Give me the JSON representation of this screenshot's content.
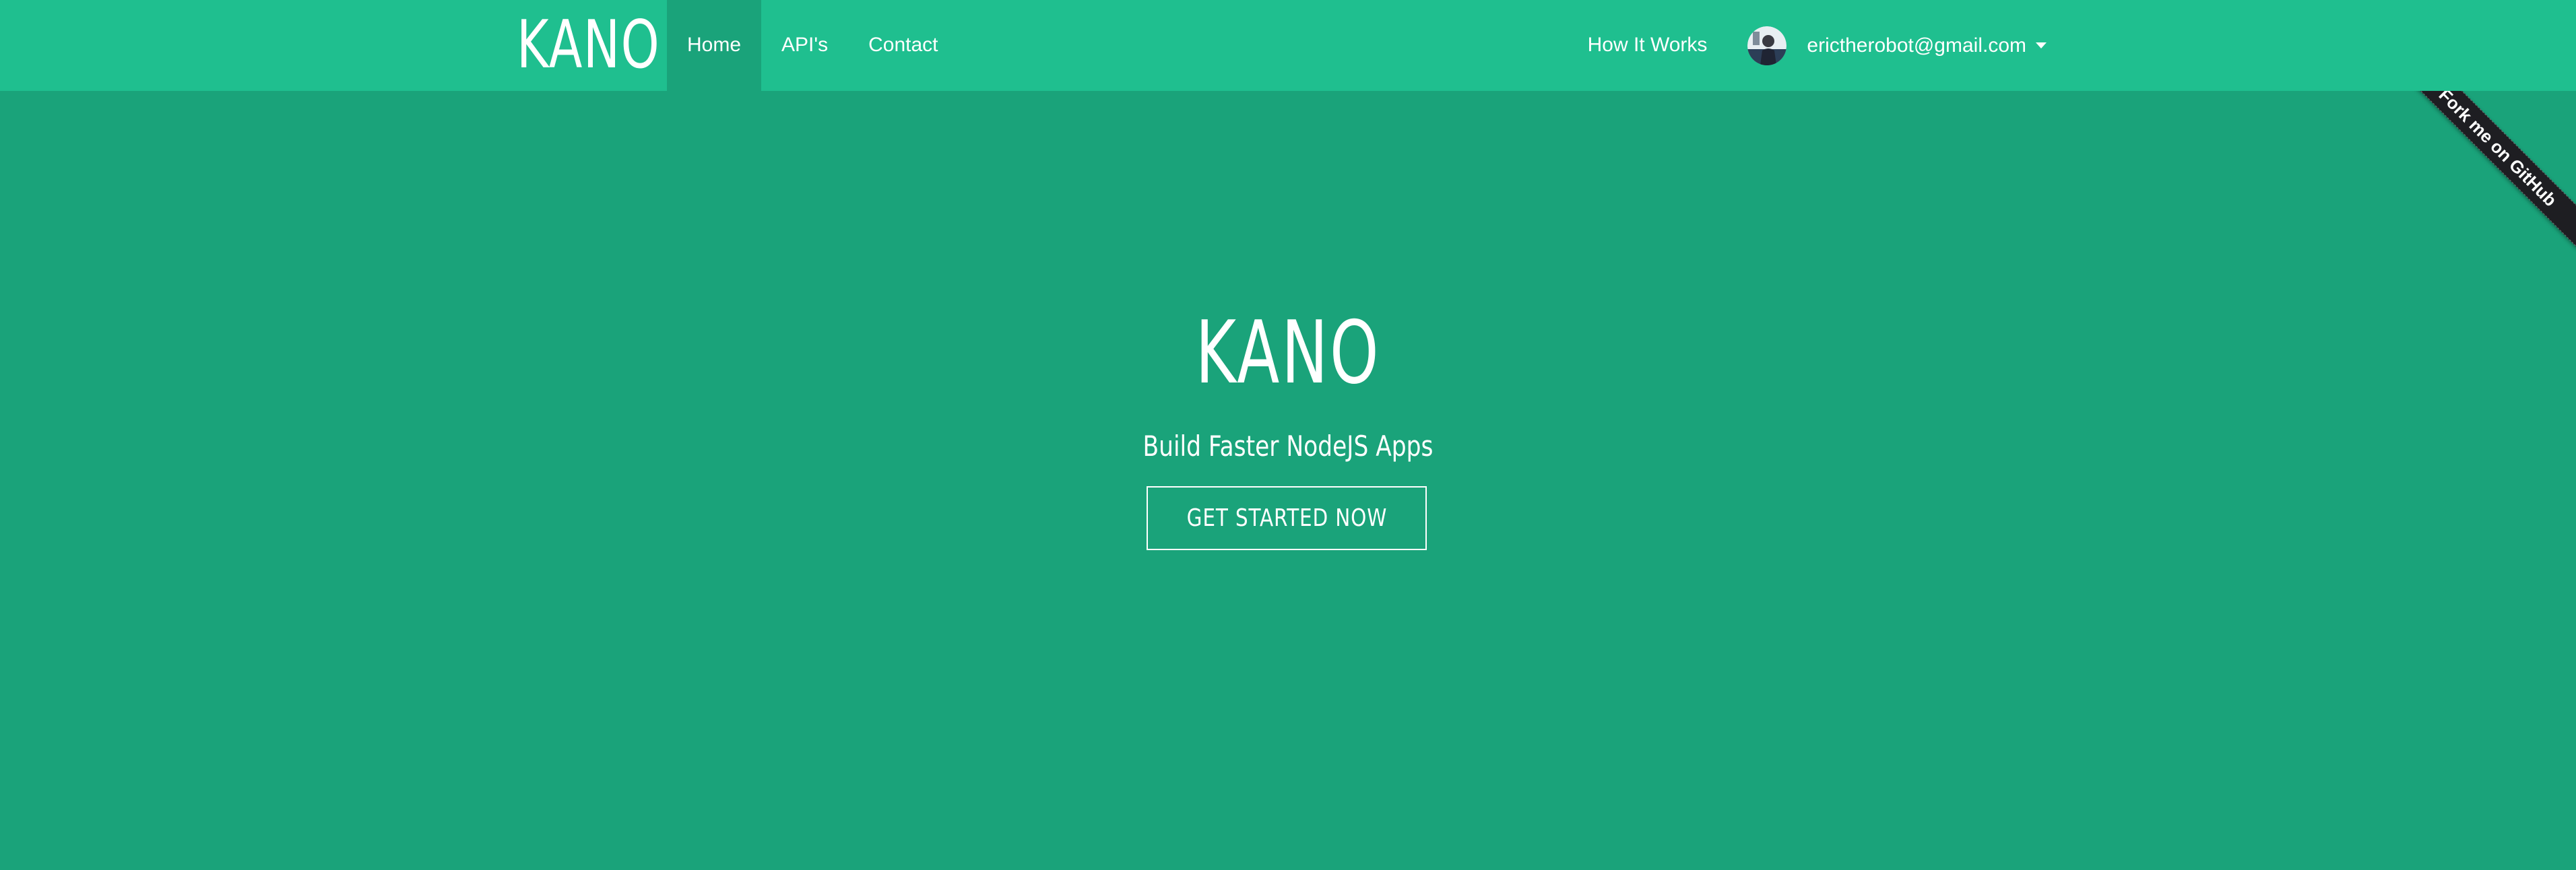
{
  "brand": {
    "name": "KANO"
  },
  "nav": {
    "left_items": [
      {
        "label": "Home",
        "active": true
      },
      {
        "label": "API's",
        "active": false
      },
      {
        "label": "Contact",
        "active": false
      }
    ],
    "right_items": [
      {
        "label": "How It Works"
      }
    ],
    "user": {
      "email": "erictherobot@gmail.com",
      "avatar_icon": "user-avatar",
      "dropdown_icon": "caret-down-icon"
    }
  },
  "hero": {
    "title": "KANO",
    "subtitle": "Build Faster NodeJS Apps",
    "cta_label": "GET STARTED NOW"
  },
  "ribbon": {
    "label": "Fork me on GitHub"
  },
  "colors": {
    "navbar": "#1fbf8f",
    "hero_background": "#1aa37a",
    "active_tab": "#1aa37a",
    "ribbon": "#1e1e22",
    "text": "#ffffff"
  }
}
